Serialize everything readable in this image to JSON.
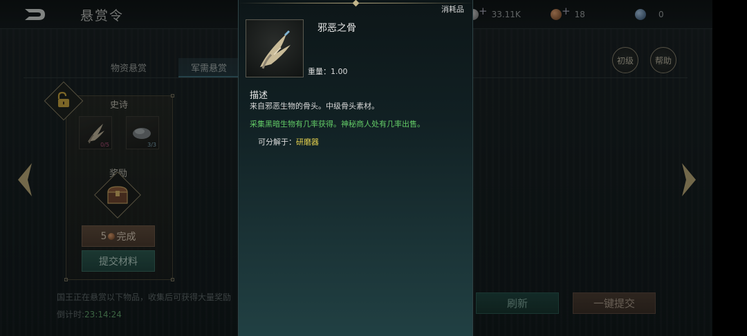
{
  "header": {
    "title": "悬赏令",
    "resources": [
      {
        "name": "currency-1",
        "value": "33.11K",
        "color": "#9b9e9e"
      },
      {
        "name": "currency-2",
        "value": "18",
        "color": "#b07a4a"
      },
      {
        "name": "currency-3",
        "value": "0",
        "color": "#5f8ab3"
      }
    ]
  },
  "tabs": [
    {
      "label": "物资悬赏"
    },
    {
      "label": "军需悬赏"
    }
  ],
  "side_buttons": {
    "level": "初级",
    "help": "帮助"
  },
  "card": {
    "rank": "史诗",
    "items": [
      {
        "icon": "claw-bone-icon",
        "count": "0/5",
        "count_color": "#b0507a"
      },
      {
        "icon": "ore-stone-icon",
        "count": "3/3",
        "count_color": "#7fa8b8"
      }
    ],
    "reward_label": "奖励",
    "complete_cost": "5",
    "complete_label": "完成",
    "submit_label": "提交材料"
  },
  "footer": {
    "description": "国王正在悬赏以下物品，收集后可获得大量奖励",
    "countdown_label": "倒计时:",
    "countdown_value": "23:14:24",
    "refresh_label": "刷新",
    "submit_all_label": "一键提交"
  },
  "tooltip": {
    "type": "消耗品",
    "name": "邪恶之骨",
    "weight_label": "重量：",
    "weight_value": "1.00",
    "desc_title": "描述",
    "desc": "来自邪恶生物的骨头。中级骨头素材。",
    "source": "采集黑暗生物有几率获得。神秘商人处有几率出售。",
    "decompose_label": "可分解于：",
    "decompose_value": "研磨器"
  }
}
